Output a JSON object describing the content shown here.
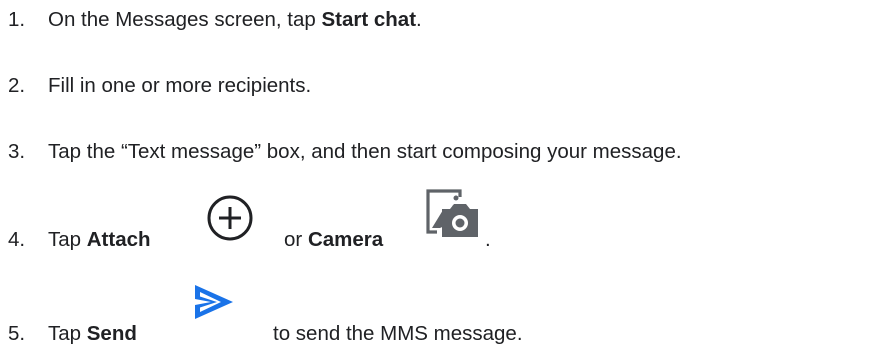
{
  "steps": [
    {
      "number": "1.",
      "text_before": "On the Messages screen, tap ",
      "bold": "Start chat",
      "text_after": "."
    },
    {
      "number": "2.",
      "text": "Fill in one or more recipients."
    },
    {
      "number": "3.",
      "text": "Tap the “Text message” box, and then start composing your message."
    },
    {
      "number": "4.",
      "tap": "Tap ",
      "attach_label": "Attach",
      "attach_icon": "add-circle-icon",
      "or": "or ",
      "camera_label": "Camera",
      "camera_icon": "gallery-camera-icon",
      "end": "."
    },
    {
      "number": "5.",
      "tap": "Tap ",
      "send_label": "Send",
      "send_icon": "send-icon",
      "send_icon_color": "#1a73e8",
      "text_after": "to send the MMS message."
    }
  ]
}
